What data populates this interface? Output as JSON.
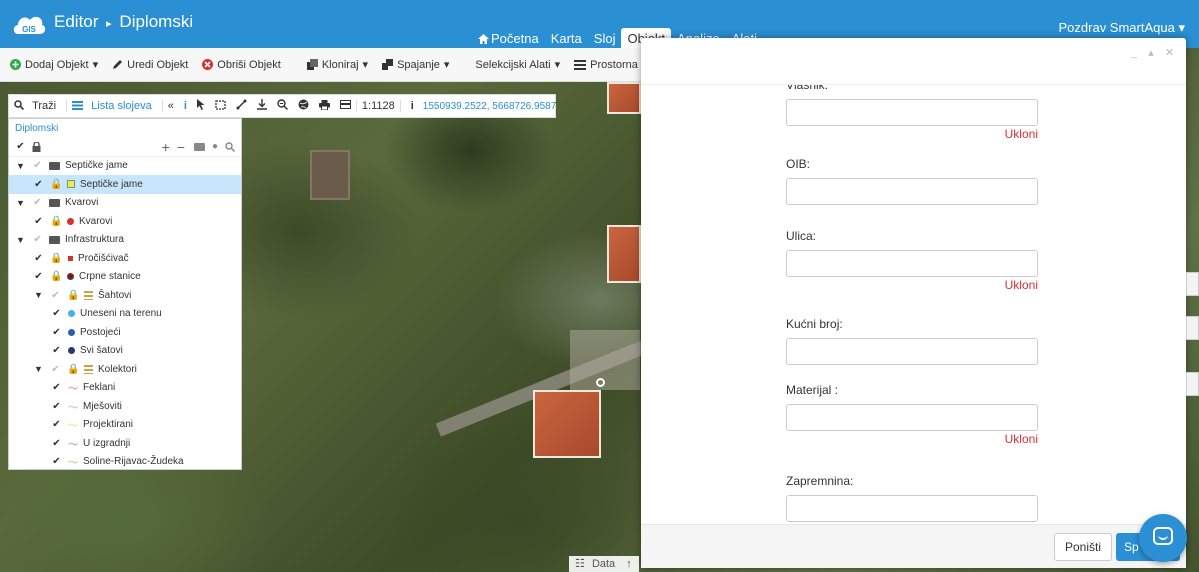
{
  "app": {
    "logo_text": "GIS",
    "title": "Editor",
    "title_sep": "▸",
    "project": "Diplomski"
  },
  "nav": {
    "items": [
      "Početna",
      "Karta",
      "Sloj",
      "Objekt",
      "Analize",
      "Alati"
    ],
    "active": "Objekt",
    "home_icon": "home-icon"
  },
  "user": {
    "greeting": "Pozdrav SmartAqua",
    "caret": "▾"
  },
  "toolbar": {
    "add": "Dodaj Objekt",
    "edit": "Uredi Objekt",
    "delete": "Obriši Objekt",
    "clone": "Kloniraj",
    "merge": "Spajanje",
    "select_tools": "Selekcijski Alati",
    "spatial_select": "Prostorna selekcija",
    "caret": "▾",
    "colors": {
      "add": "#2eaa47",
      "delete": "#d9302c"
    }
  },
  "map_toolbar": {
    "search": "Traži",
    "layers": "Lista slojeva",
    "collapse": "«",
    "scale": "1:1128",
    "coords": "1550939.2522, 5668726.9587"
  },
  "layer_panel": {
    "breadcrumb": "Diplomski",
    "rows": [
      {
        "label": "Septičke jame",
        "type": "group",
        "indent": 0
      },
      {
        "label": "Septičke jame",
        "type": "layer",
        "indent": 1,
        "symbol": "square",
        "color": "#e5f04a",
        "selected": true
      },
      {
        "label": "Kvarovi",
        "type": "group",
        "indent": 0
      },
      {
        "label": "Kvarovi",
        "type": "layer",
        "indent": 1,
        "symbol": "dot",
        "color": "#d9302c"
      },
      {
        "label": "Infrastruktura",
        "type": "group",
        "indent": 0
      },
      {
        "label": "Pročišćivač",
        "type": "layer",
        "indent": 1,
        "symbol": "small-square",
        "color": "#d9302c"
      },
      {
        "label": "Crpne stanice",
        "type": "layer",
        "indent": 1,
        "symbol": "ring",
        "color": "#8a1f1f"
      },
      {
        "label": "Šahtovi",
        "type": "subgroup",
        "indent": 1
      },
      {
        "label": "Uneseni na terenu",
        "type": "layer",
        "indent": 2,
        "symbol": "dot",
        "color": "#3fb4e6"
      },
      {
        "label": "Postojeći",
        "type": "layer",
        "indent": 2,
        "symbol": "dot",
        "color": "#2a5fa8"
      },
      {
        "label": "Svi šatovi",
        "type": "layer",
        "indent": 2,
        "symbol": "dot",
        "color": "#2b3a6b"
      },
      {
        "label": "Kolektori",
        "type": "subgroup",
        "indent": 1
      },
      {
        "label": "Feklani",
        "type": "layer",
        "indent": 2,
        "symbol": "line",
        "color": "#e56bc4"
      },
      {
        "label": "Mješoviti",
        "type": "layer",
        "indent": 2,
        "symbol": "line",
        "color": "#e0a0b8"
      },
      {
        "label": "Projektirani",
        "type": "layer",
        "indent": 2,
        "symbol": "line",
        "color": "#f2d96b"
      },
      {
        "label": "U izgradnji",
        "type": "layer",
        "indent": 2,
        "symbol": "line",
        "color": "#999999"
      },
      {
        "label": "Soline-Rijavac-Žudeka",
        "type": "layer",
        "indent": 2,
        "symbol": "line",
        "color": "#9ccf6a"
      }
    ]
  },
  "modal": {
    "controls": "_ ▴ ✕",
    "fields": [
      {
        "label": "Vlasnik:",
        "value": "",
        "remove": "Ukloni"
      },
      {
        "label": "OIB:",
        "value": "",
        "remove": ""
      },
      {
        "label": "Ulica:",
        "value": "",
        "remove": "Ukloni"
      },
      {
        "label": "Kućni broj:",
        "value": "",
        "remove": ""
      },
      {
        "label": "Materijal :",
        "value": "",
        "remove": "Ukloni"
      },
      {
        "label": "Zapremnina:",
        "value": "",
        "remove": ""
      }
    ],
    "cancel": "Poništi",
    "save": "Sp"
  },
  "databar": {
    "label": "Data"
  }
}
